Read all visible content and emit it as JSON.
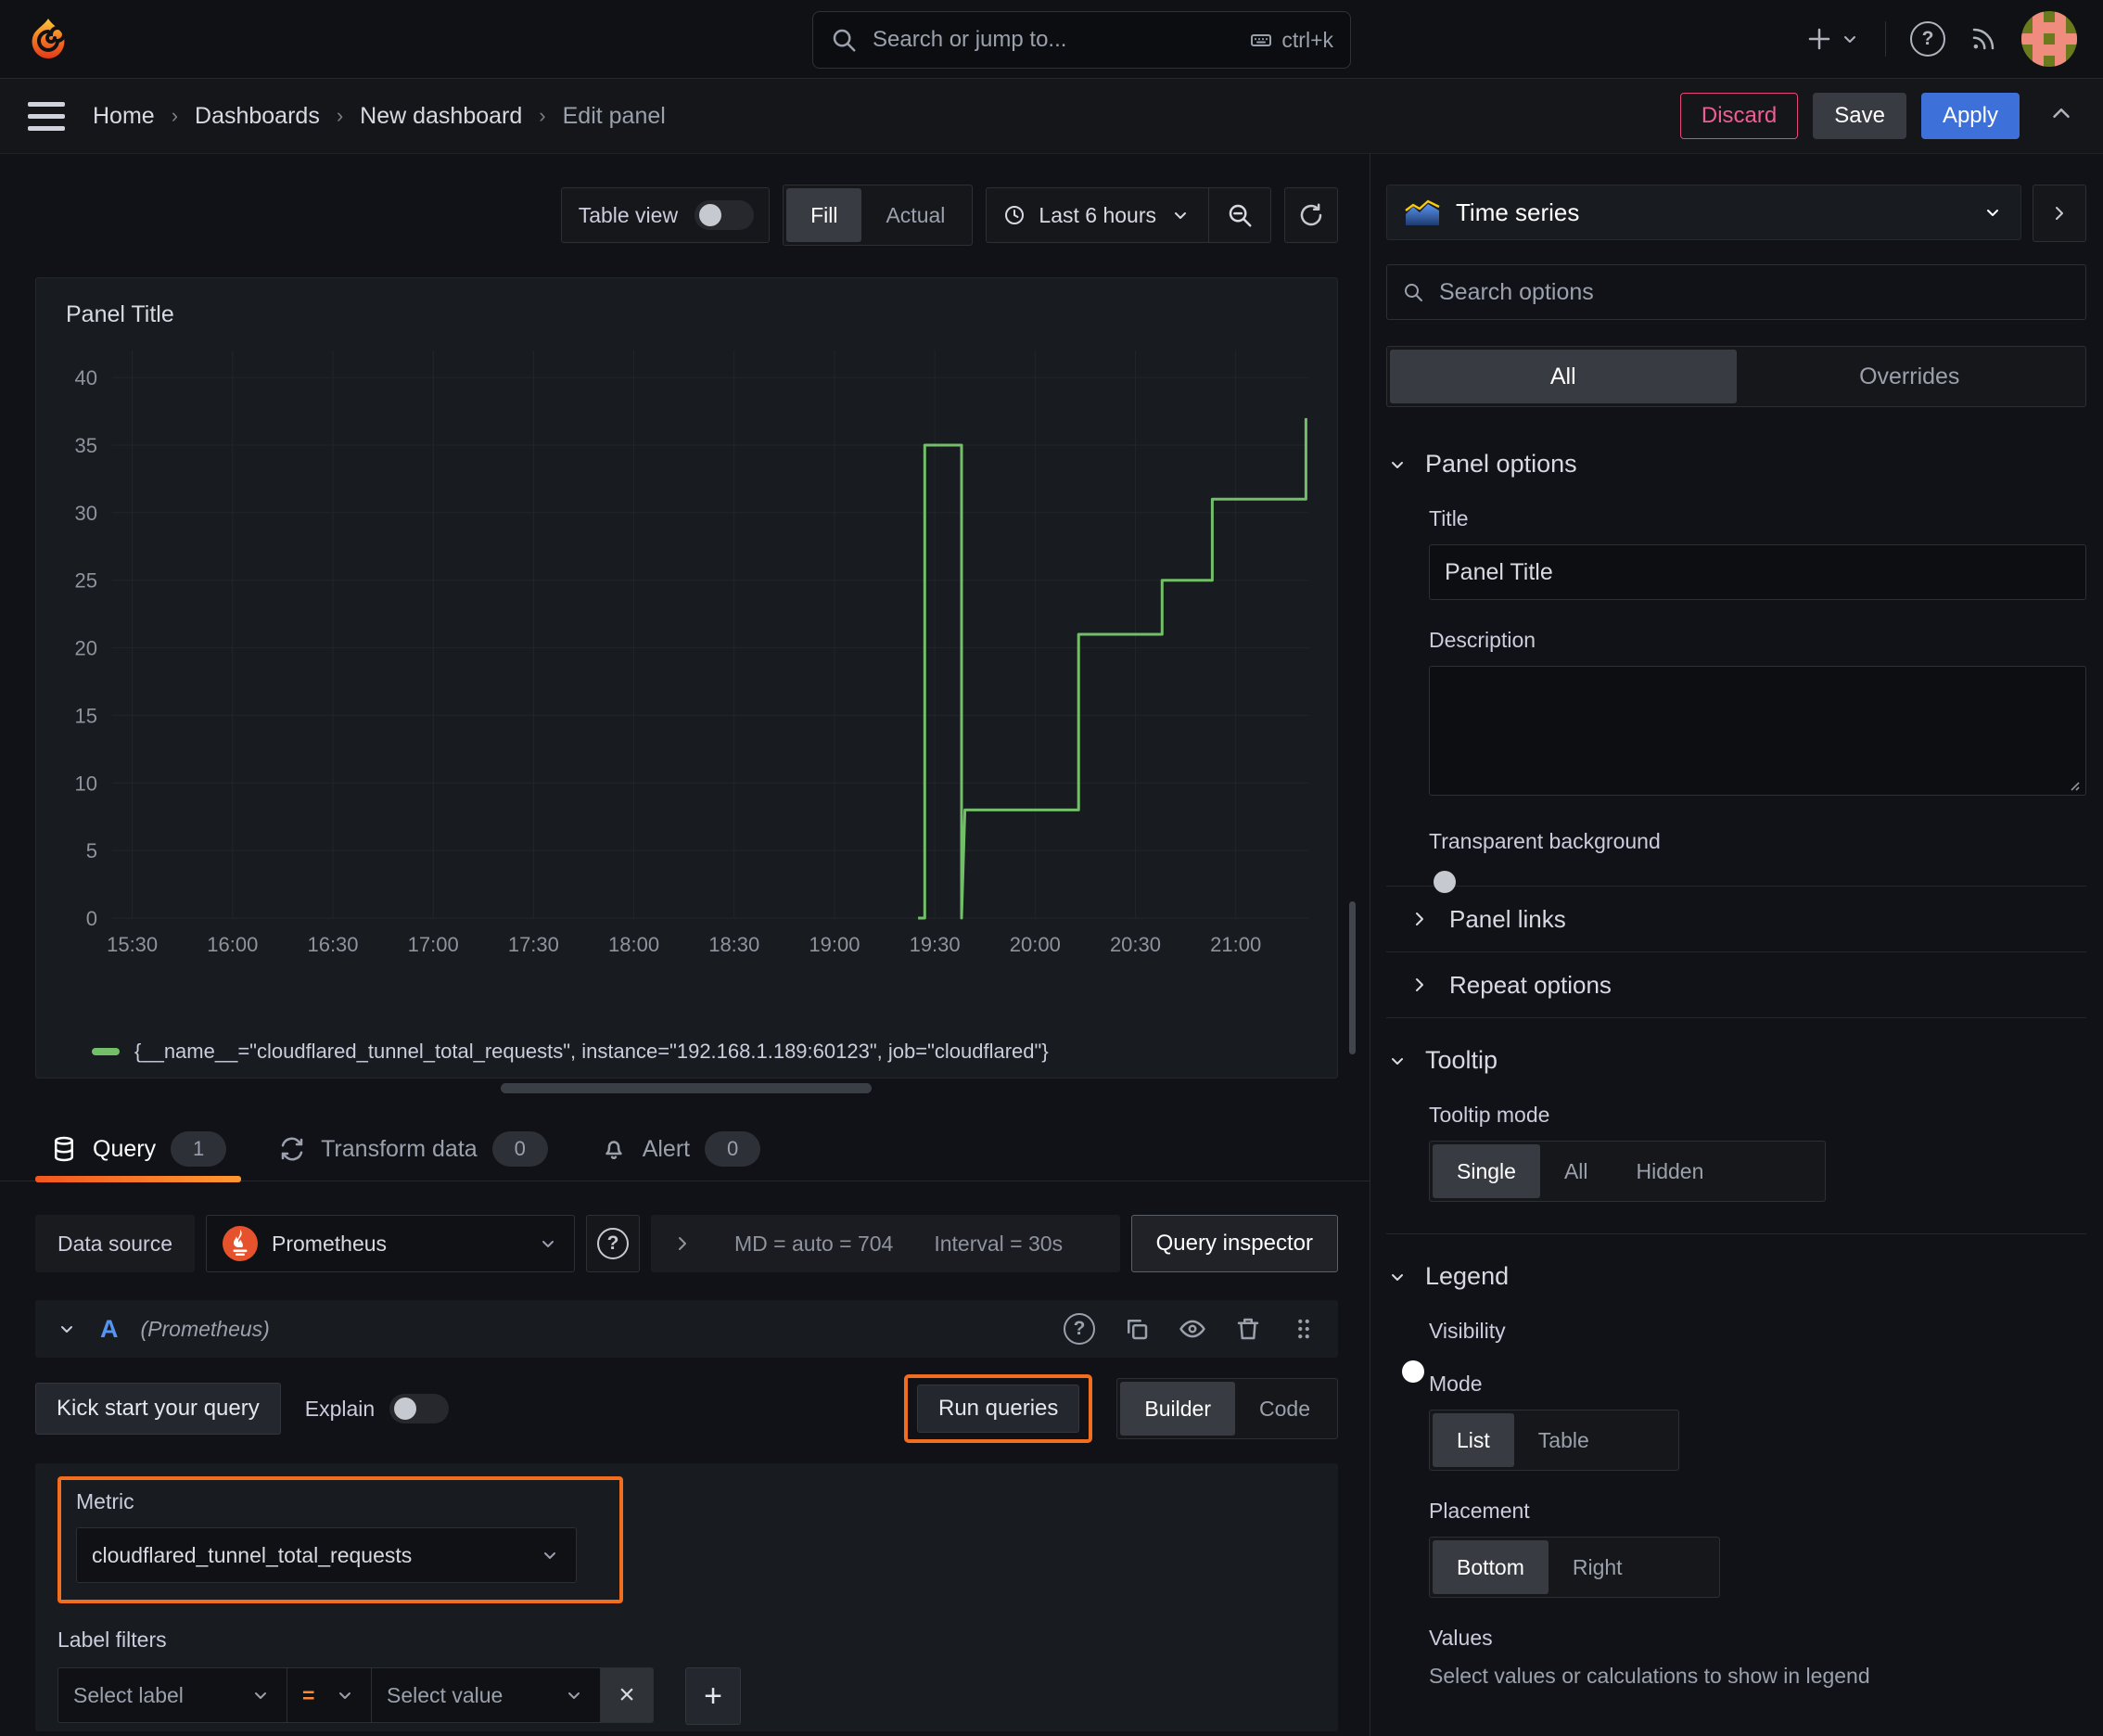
{
  "topbar": {
    "search_placeholder": "Search or jump to...",
    "search_shortcut": "ctrl+k"
  },
  "nav": {
    "breadcrumbs": [
      "Home",
      "Dashboards",
      "New dashboard",
      "Edit panel"
    ],
    "discard": "Discard",
    "save": "Save",
    "apply": "Apply"
  },
  "toolbar": {
    "table_view": "Table view",
    "fill": "Fill",
    "actual": "Actual",
    "time_range": "Last 6 hours"
  },
  "panel": {
    "title": "Panel Title",
    "legend": "{__name__=\"cloudflared_tunnel_total_requests\", instance=\"192.168.1.189:60123\", job=\"cloudflared\"}"
  },
  "chart_data": {
    "type": "line",
    "step": true,
    "title": "Panel Title",
    "x_ticks": [
      "15:30",
      "16:00",
      "16:30",
      "17:00",
      "17:30",
      "18:00",
      "18:30",
      "19:00",
      "19:30",
      "20:00",
      "20:30",
      "21:00"
    ],
    "x_range": [
      "15:24",
      "21:22"
    ],
    "y_ticks": [
      0,
      5,
      10,
      15,
      20,
      25,
      30,
      35,
      40
    ],
    "ylim": [
      0,
      42
    ],
    "grid": true,
    "legend_position": "bottom",
    "series": [
      {
        "name": "{__name__=\"cloudflared_tunnel_total_requests\", instance=\"192.168.1.189:60123\", job=\"cloudflared\"}",
        "color": "#73bf69",
        "points": [
          [
            "19:25",
            0
          ],
          [
            "19:27",
            0
          ],
          [
            "19:27",
            35
          ],
          [
            "19:38",
            35
          ],
          [
            "19:38",
            0
          ],
          [
            "19:39",
            8
          ],
          [
            "20:13",
            8
          ],
          [
            "20:13",
            21
          ],
          [
            "20:38",
            21
          ],
          [
            "20:38",
            25
          ],
          [
            "20:53",
            25
          ],
          [
            "20:53",
            31
          ],
          [
            "21:21",
            31
          ],
          [
            "21:21",
            37
          ]
        ]
      }
    ]
  },
  "tabs": {
    "query": "Query",
    "query_count": "1",
    "transform": "Transform data",
    "transform_count": "0",
    "alert": "Alert",
    "alert_count": "0"
  },
  "datasource": {
    "label": "Data source",
    "name": "Prometheus",
    "md": "MD = auto = 704",
    "interval": "Interval = 30s",
    "inspector": "Query inspector"
  },
  "query": {
    "ref": "A",
    "ds_hint": "(Prometheus)",
    "kickstart": "Kick start your query",
    "explain": "Explain",
    "run": "Run queries",
    "builder": "Builder",
    "code": "Code",
    "metric_label": "Metric",
    "metric": "cloudflared_tunnel_total_requests",
    "label_filters": "Label filters",
    "select_label": "Select label",
    "op": "=",
    "select_value": "Select value"
  },
  "options": {
    "viz": "Time series",
    "search_placeholder": "Search options",
    "tab_all": "All",
    "tab_overrides": "Overrides",
    "panel_options": "Panel options",
    "title_label": "Title",
    "title_value": "Panel Title",
    "description_label": "Description",
    "transparent": "Transparent background",
    "panel_links": "Panel links",
    "repeat": "Repeat options",
    "tooltip": "Tooltip",
    "tooltip_mode": "Tooltip mode",
    "single": "Single",
    "all": "All",
    "hidden": "Hidden",
    "legend": "Legend",
    "visibility": "Visibility",
    "mode": "Mode",
    "list": "List",
    "table": "Table",
    "placement": "Placement",
    "bottom": "Bottom",
    "right": "Right",
    "values": "Values",
    "values_help": "Select values or calculations to show in legend"
  },
  "colors": {
    "accent_orange": "#f26e1f",
    "series_green": "#73bf69",
    "primary_blue": "#3d71d9",
    "danger_pink": "#e64578"
  }
}
